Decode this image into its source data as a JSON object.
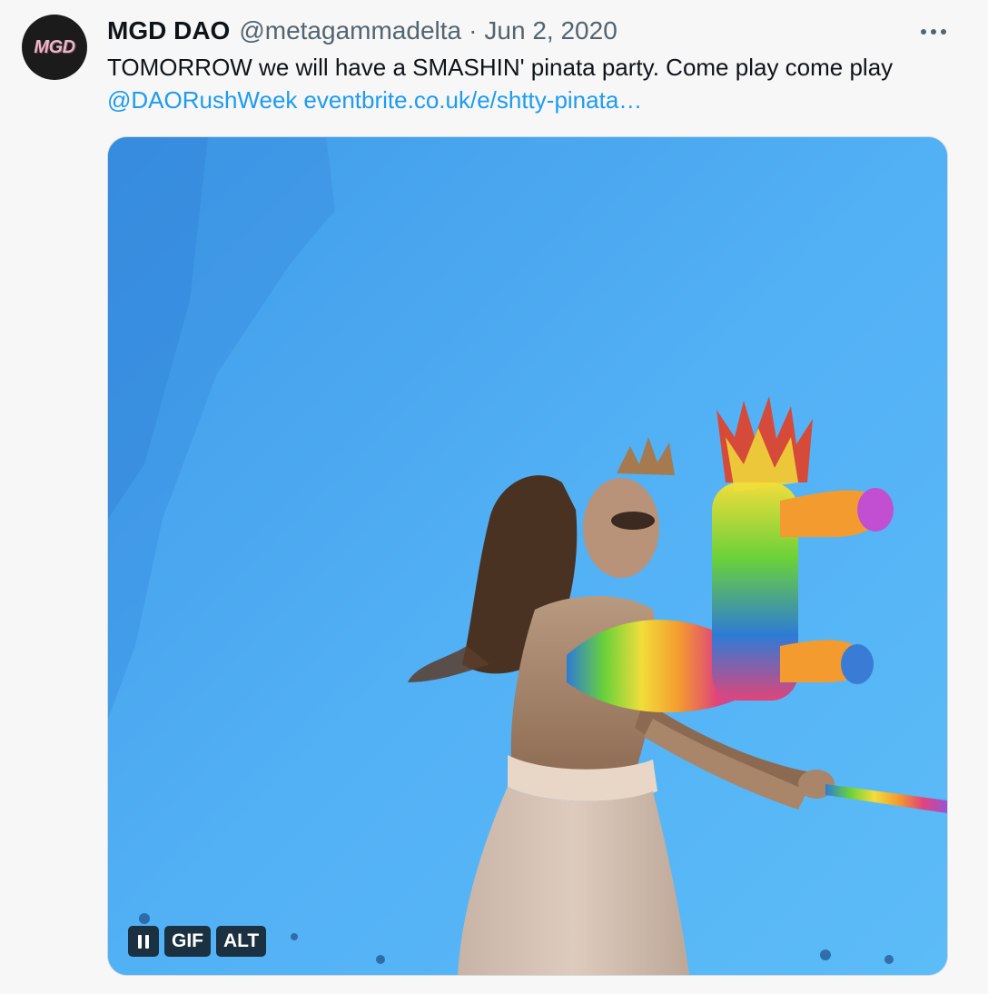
{
  "tweet": {
    "avatar_text": "MGD",
    "display_name": "MGD DAO",
    "handle": "@metagammadelta",
    "separator": "·",
    "date": "Jun 2, 2020",
    "more_icon": "more-horizontal-icon",
    "text": "TOMORROW we will have a SMASHIN' pinata party. Come play come play",
    "mention": "@DAORushWeek",
    "link": "eventbrite.co.uk/e/shtty-pinata…"
  },
  "media": {
    "type": "gif",
    "pause_icon": "pause-icon",
    "gif_label": "GIF",
    "alt_label": "ALT"
  },
  "colors": {
    "link": "#1d9bf0",
    "secondary_text": "#536471",
    "primary_text": "#0f1419",
    "media_sky": "#54b4f5"
  }
}
